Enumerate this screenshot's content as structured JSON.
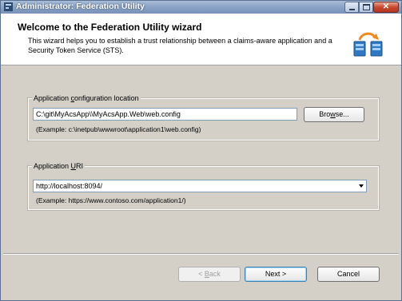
{
  "window": {
    "title": "Administrator: Federation Utility",
    "controls": {
      "minimize_icon": "minimize-icon",
      "maximize_icon": "maximize-icon",
      "close_icon": "close-icon"
    }
  },
  "header": {
    "title": "Welcome to the Federation Utility wizard",
    "description": "This wizard helps you to establish a trust relationship between a claims-aware application and a Security Token Service (STS).",
    "logo_icon": "federation-wizard-icon"
  },
  "app_config": {
    "label_pre": "Application ",
    "label_accel": "c",
    "label_post": "onfiguration location",
    "value": "C:\\git\\MyAcsApp\\\\MyAcsApp.Web\\web.config",
    "browse_pre": "Bro",
    "browse_accel": "w",
    "browse_post": "se...",
    "example": "(Example: c:\\inetpub\\wwwroot\\application1\\web.config)"
  },
  "app_uri": {
    "label_pre": "Application ",
    "label_accel": "U",
    "label_post": "RI",
    "value": "http://localhost:8094/",
    "example": "(Example: https://www.contoso.com/application1/)"
  },
  "footer": {
    "back_pre": "< ",
    "back_accel": "B",
    "back_post": "ack",
    "next_label": "Next >",
    "cancel_label": "Cancel"
  },
  "colors": {
    "face": "#d4d0c8",
    "titlebar": "#8aa3c6",
    "close": "#c9482f",
    "focus": "#3c7fb1"
  }
}
